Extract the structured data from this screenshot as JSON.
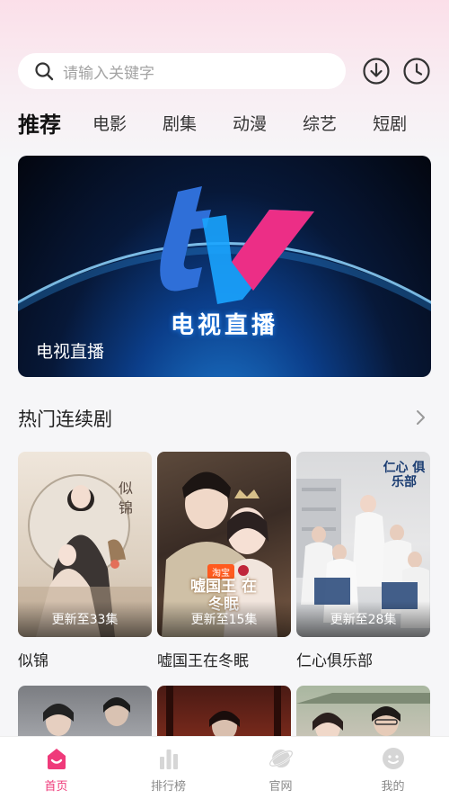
{
  "search": {
    "placeholder": "请输入关键字"
  },
  "tabs": [
    "推荐",
    "电影",
    "剧集",
    "动漫",
    "综艺",
    "短剧"
  ],
  "banner": {
    "logo_text": "电视直播",
    "caption": "电视直播"
  },
  "section": {
    "title": "热门连续剧"
  },
  "cards": [
    {
      "title": "似锦",
      "episode": "更新至33集"
    },
    {
      "title": "嘘国王在冬眠",
      "episode": "更新至15集"
    },
    {
      "title": "仁心俱乐部",
      "episode": "更新至28集"
    }
  ],
  "poster_texts": {
    "p1_calligraphy": "似锦",
    "p2_badge": "淘宝",
    "p2_title": "嘘国王 在冬眠",
    "p3_title": "仁心 俱乐部"
  },
  "bottom_nav": [
    {
      "label": "首页",
      "icon": "home-icon",
      "active": true
    },
    {
      "label": "排行榜",
      "icon": "ranking-icon",
      "active": false
    },
    {
      "label": "官网",
      "icon": "planet-icon",
      "active": false
    },
    {
      "label": "我的",
      "icon": "profile-icon",
      "active": false
    }
  ],
  "colors": {
    "accent": "#ef3a7a",
    "header_pink": "#fbdfe9",
    "inactive_icon": "#d6d6d6"
  }
}
